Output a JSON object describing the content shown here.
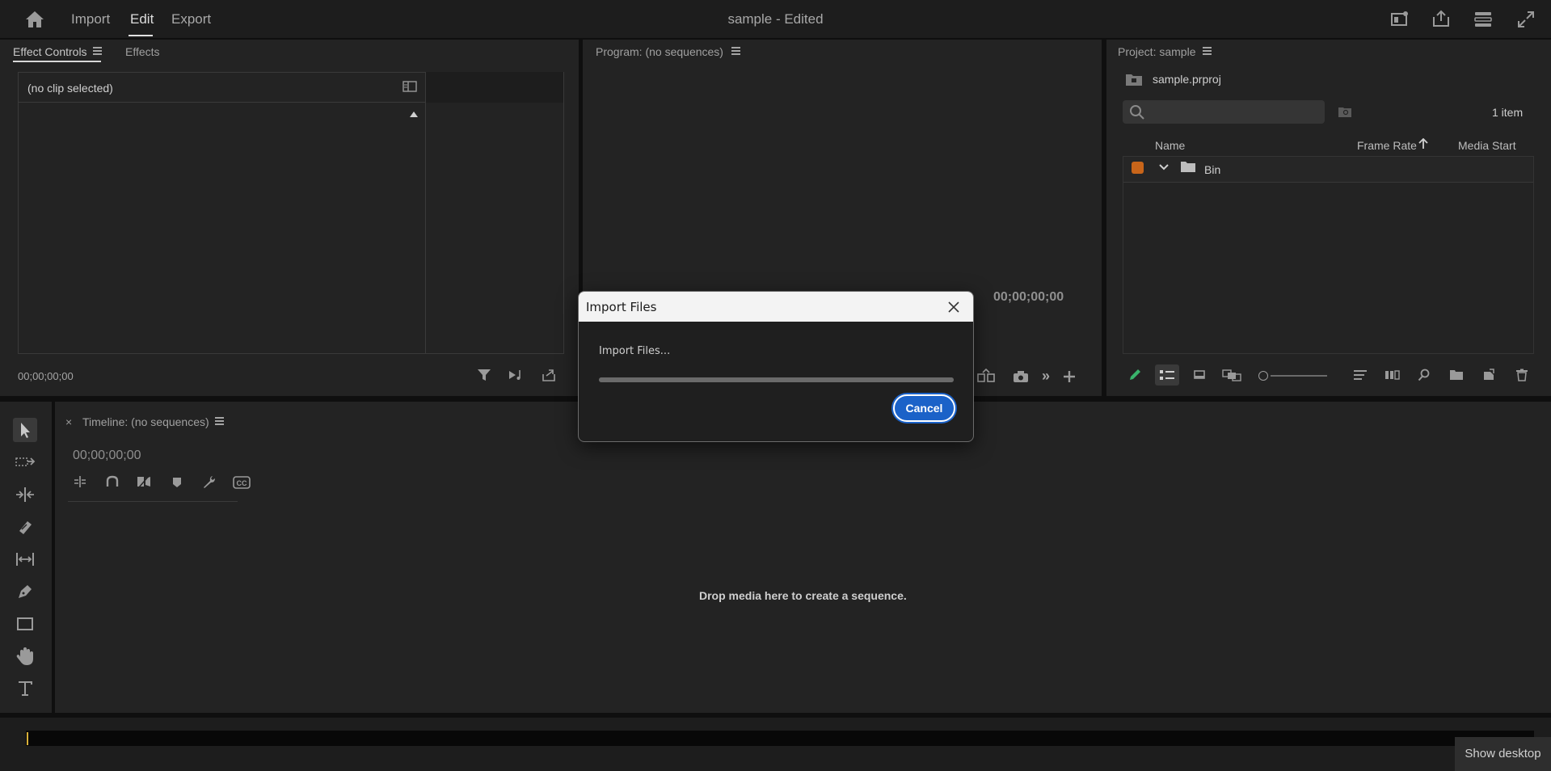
{
  "topbar": {
    "tabs": [
      "Import",
      "Edit",
      "Export"
    ],
    "active_tab": "Edit",
    "title": "sample - Edited"
  },
  "effect_controls": {
    "tab_label": "Effect Controls",
    "effects_tab": "Effects",
    "no_clip": "(no clip selected)",
    "timecode": "00;00;00;00"
  },
  "program": {
    "label": "Program: (no sequences)",
    "timecode": "00;00;00;00"
  },
  "project": {
    "label": "Project: sample",
    "file": "sample.prproj",
    "item_count": "1 item",
    "search_placeholder": "",
    "columns": [
      "Name",
      "Frame Rate",
      "Media Start"
    ],
    "bin_name": "Bin",
    "bin_color": "#c8651a"
  },
  "timeline": {
    "label": "Timeline: (no sequences)",
    "timecode": "00;00;00;00",
    "drop_hint": "Drop media here to create a sequence."
  },
  "dialog": {
    "title": "Import Files",
    "message": "Import Files...",
    "progress_fraction": 1.0,
    "cancel_label": "Cancel"
  },
  "taskbar": {
    "show_desktop": "Show desktop"
  },
  "colors": {
    "accent": "#1b62c8",
    "panel_bg": "#232323",
    "app_bg": "#0f0f0f"
  }
}
